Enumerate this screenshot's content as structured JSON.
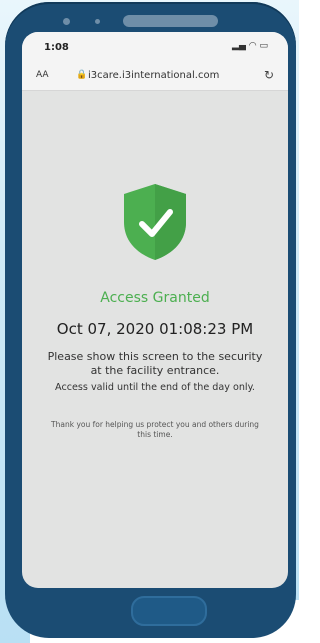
{
  "status_bar": {
    "time": "1:08",
    "icons": [
      "signal-icon",
      "wifi-icon",
      "battery-icon"
    ]
  },
  "browser": {
    "text_size_label": "AA",
    "url": "i3care.i3international.com",
    "icons": [
      "lock-icon",
      "reload-icon"
    ]
  },
  "content": {
    "status": "Access Granted",
    "datetime": "Oct 07, 2020 01:08:23 PM",
    "instruction": "Please show this screen to the security at the facility entrance.",
    "validity": "Access valid until the end of the day only.",
    "thanks": "Thank you for helping us protect you and others during this time."
  },
  "colors": {
    "phone_frame": "#1b4c73",
    "screen_bg": "#e2e3e2",
    "accent_green": "#4caf50"
  },
  "icons": [
    "shield-check-icon"
  ]
}
